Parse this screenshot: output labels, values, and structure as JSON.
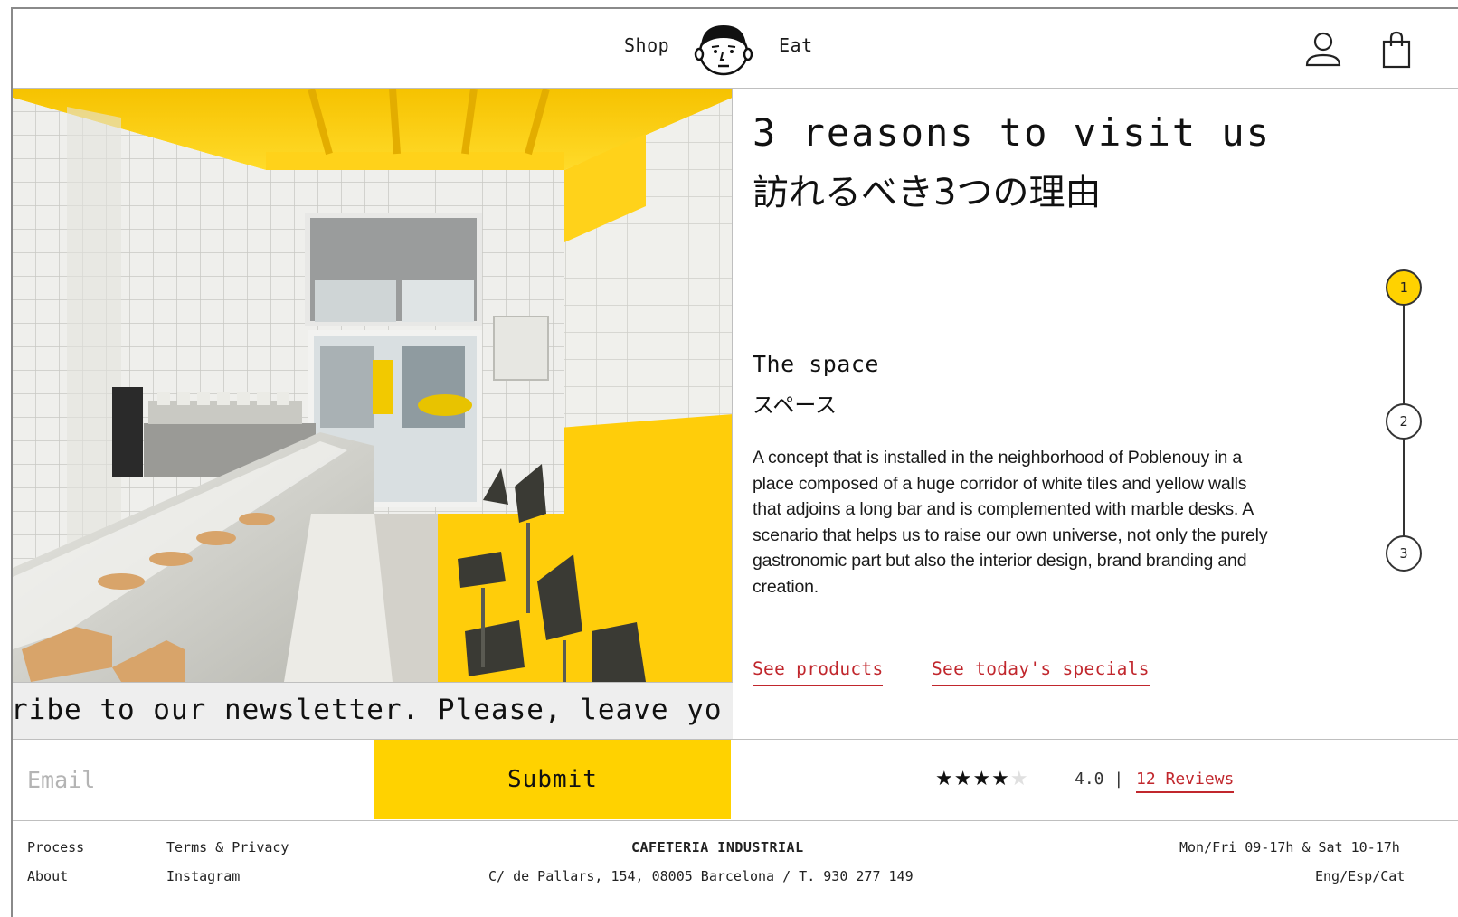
{
  "header": {
    "nav_left": "Shop",
    "nav_right": "Eat",
    "logo_icon": "face-logo-icon",
    "account_icon": "user-icon",
    "cart_icon": "shopping-bag-icon"
  },
  "newsletter": {
    "marquee_text": "ribe to our newsletter. Please, leave yo",
    "email_placeholder": "Email",
    "submit_label": "Submit"
  },
  "content": {
    "title_en": "3 reasons to visit us",
    "title_jp": "訪れるべき3つの理由",
    "section_en": "The space",
    "section_jp": "スペース",
    "description": "A concept that is installed in the neighborhood of Poblenouy in a place composed of a huge corridor of white tiles and yellow walls that adjoins a long bar and is complemented with marble desks. A scenario that helps us to raise our own universe, not only the purely gastronomic part but also the interior design, brand branding and creation.",
    "link_products": "See products",
    "link_specials": "See today's specials"
  },
  "stepper": {
    "steps": [
      "1",
      "2",
      "3"
    ],
    "active_step": "1"
  },
  "rating": {
    "stars_filled": "★★★★",
    "stars_empty": "★",
    "score_text": "4.0 |",
    "reviews_label": "12 Reviews"
  },
  "footer": {
    "process": "Process",
    "about": "About",
    "terms": "Terms & Privacy",
    "instagram": "Instagram",
    "brand": "CAFETERIA INDUSTRIAL",
    "address": "C/ de Pallars, 154, 08005 Barcelona / T. 930 277 149",
    "hours": "Mon/Fri 09-17h & Sat 10-17h",
    "languages": "Eng/Esp/Cat"
  },
  "colors": {
    "accent_yellow": "#ffd200",
    "link_red": "#c1272d",
    "border_gray": "#bfbfbf"
  }
}
